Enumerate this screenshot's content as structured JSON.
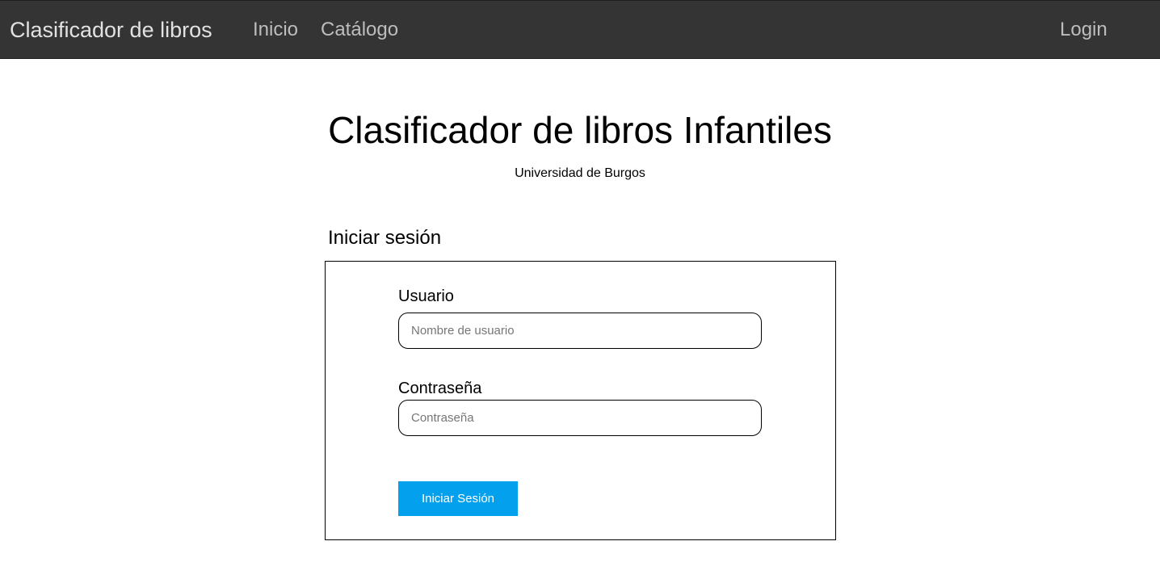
{
  "navbar": {
    "brand": "Clasificador de libros",
    "links": [
      "Inicio",
      "Catálogo"
    ],
    "login": "Login",
    "background": "#343434"
  },
  "header": {
    "title": "Clasificador de libros Infantiles",
    "subtitle": "Universidad de Burgos"
  },
  "login_form": {
    "heading": "Iniciar sesión",
    "username_label": "Usuario",
    "username_placeholder": "Nombre de usuario",
    "username_value": "",
    "password_label": "Contraseña",
    "password_placeholder": "Contraseña",
    "password_value": "",
    "submit_label": "Iniciar Sesión",
    "submit_color": "#03a0ee"
  }
}
